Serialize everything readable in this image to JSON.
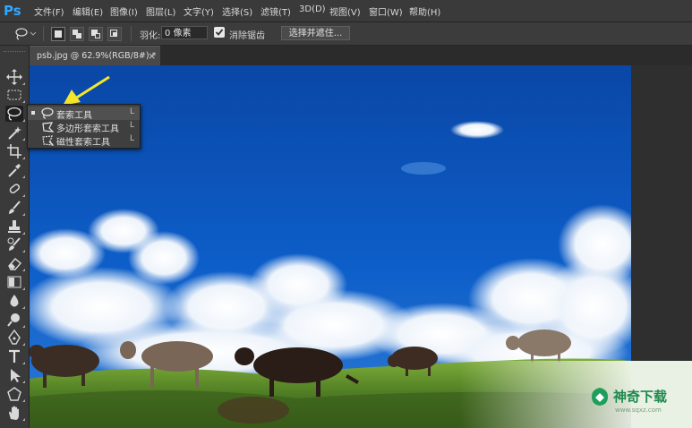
{
  "app": {
    "logo": "Ps"
  },
  "menu": [
    "文件(F)",
    "编辑(E)",
    "图像(I)",
    "图层(L)",
    "文字(Y)",
    "选择(S)",
    "滤镜(T)",
    "3D(D)",
    "视图(V)",
    "窗口(W)",
    "帮助(H)"
  ],
  "options": {
    "feather_label": "羽化:",
    "feather_value": "0 像素",
    "antialias_label": "消除锯齿",
    "antialias_checked": true,
    "select_mask_button": "选择并遮住..."
  },
  "tab": {
    "title": "psb.jpg @ 62.9%(RGB/8#) *",
    "close": "×"
  },
  "flyout": [
    {
      "label": "套索工具",
      "key": "L",
      "selected": true,
      "icon": "lasso-icon"
    },
    {
      "label": "多边形套索工具",
      "key": "L",
      "selected": false,
      "icon": "polygonal-lasso-icon"
    },
    {
      "label": "磁性套索工具",
      "key": "L",
      "selected": false,
      "icon": "magnetic-lasso-icon"
    }
  ],
  "tools": [
    "move-tool-icon",
    "marquee-tool-icon",
    "lasso-tool-icon",
    "magic-wand-icon",
    "crop-icon",
    "eyedropper-icon",
    "healing-brush-icon",
    "brush-icon",
    "stamp-icon",
    "history-brush-icon",
    "eraser-icon",
    "gradient-icon",
    "blur-icon",
    "dodge-icon",
    "pen-icon",
    "type-icon",
    "path-select-icon",
    "shape-icon",
    "hand-icon"
  ],
  "watermark": {
    "text": "神奇下载",
    "sub": "www.sqxz.com"
  },
  "colors": {
    "accent": "#31a8ff",
    "arrow": "#f5e62a",
    "sky": "#0b52b8"
  }
}
